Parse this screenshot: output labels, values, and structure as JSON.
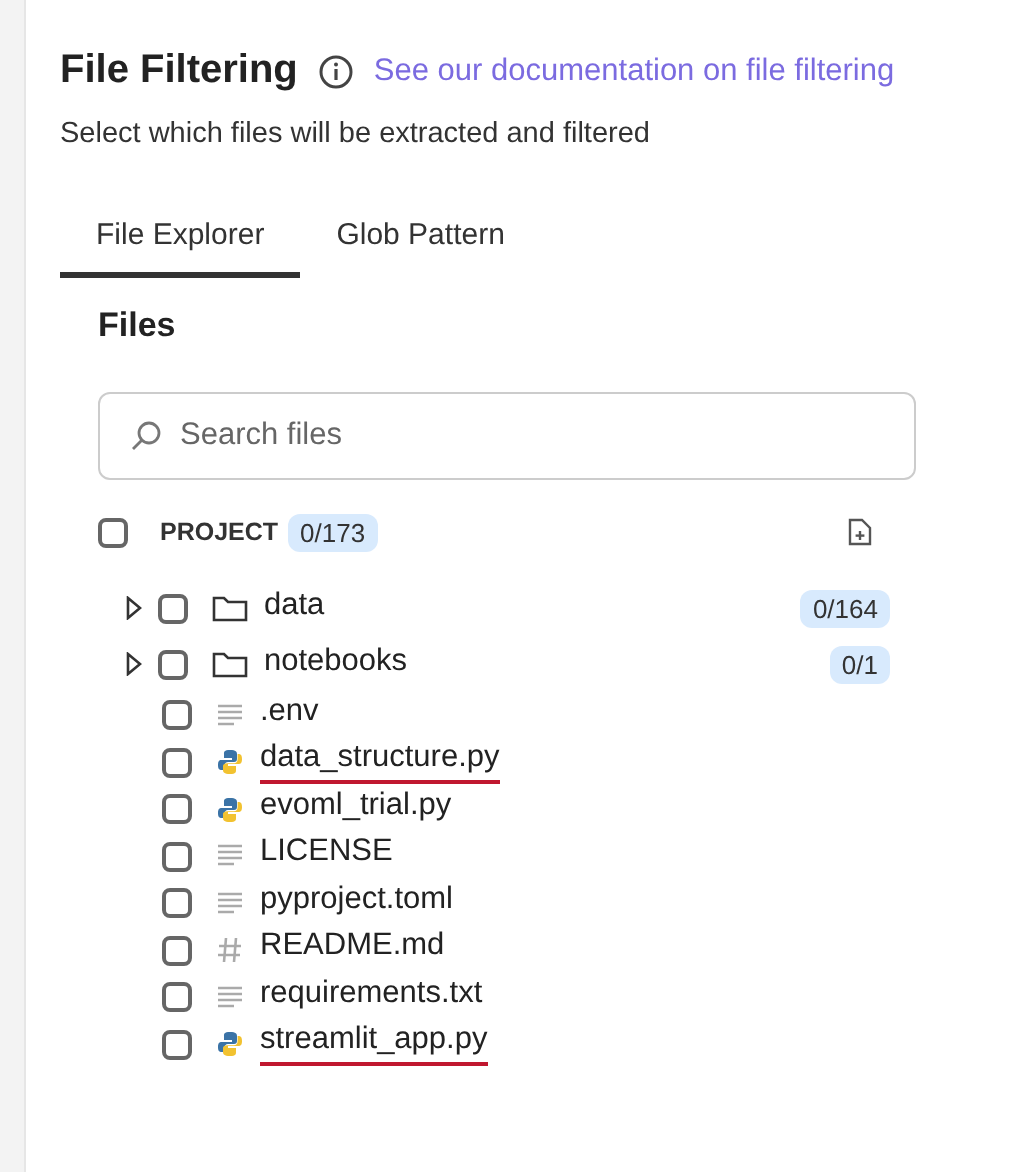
{
  "header": {
    "title": "File Filtering",
    "link": "See our documentation on file filtering",
    "subtitle": "Select which files will be extracted and filtered"
  },
  "tabs": [
    {
      "label": "File Explorer",
      "selected": true
    },
    {
      "label": "Glob Pattern",
      "selected": false
    }
  ],
  "files_heading": "Files",
  "search": {
    "placeholder": "Search files"
  },
  "project": {
    "label": "PROJECT",
    "count": "0/173",
    "checked": false
  },
  "items": [
    {
      "kind": "folder",
      "name": "data",
      "count": "0/164",
      "checked": false,
      "expanded": false,
      "underlined": false
    },
    {
      "kind": "folder",
      "name": "notebooks",
      "count": "0/1",
      "checked": false,
      "expanded": false,
      "underlined": false
    },
    {
      "kind": "text",
      "name": ".env",
      "checked": false,
      "underlined": false
    },
    {
      "kind": "python",
      "name": "data_structure.py",
      "checked": false,
      "underlined": true
    },
    {
      "kind": "python",
      "name": "evoml_trial.py",
      "checked": false,
      "underlined": false
    },
    {
      "kind": "text",
      "name": "LICENSE",
      "checked": false,
      "underlined": false
    },
    {
      "kind": "text",
      "name": "pyproject.toml",
      "checked": false,
      "underlined": false
    },
    {
      "kind": "markdown",
      "name": "README.md",
      "checked": false,
      "underlined": false
    },
    {
      "kind": "text",
      "name": "requirements.txt",
      "checked": false,
      "underlined": false
    },
    {
      "kind": "python",
      "name": "streamlit_app.py",
      "checked": false,
      "underlined": true
    }
  ]
}
